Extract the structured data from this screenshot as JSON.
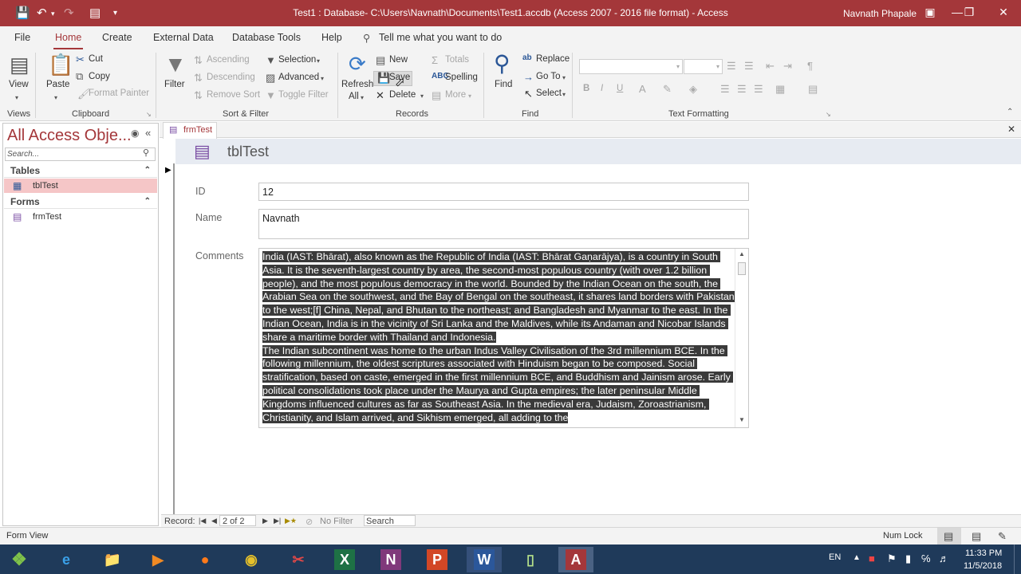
{
  "titlebar": {
    "title": "Test1 : Database- C:\\Users\\Navnath\\Documents\\Test1.accdb (Access 2007 - 2016 file format)  -  Access",
    "user": "Navnath Phapale"
  },
  "menu": {
    "items": [
      "File",
      "Home",
      "Create",
      "External Data",
      "Database Tools",
      "Help"
    ],
    "active": "Home",
    "tell_me": "Tell me what you want to do"
  },
  "ribbon": {
    "views": {
      "view": "View",
      "group": "Views"
    },
    "clipboard": {
      "paste": "Paste",
      "cut": "Cut",
      "copy": "Copy",
      "format_painter": "Format Painter",
      "group": "Clipboard"
    },
    "sort_filter": {
      "filter": "Filter",
      "ascending": "Ascending",
      "descending": "Descending",
      "remove_sort": "Remove Sort",
      "selection": "Selection",
      "advanced": "Advanced",
      "toggle_filter": "Toggle Filter",
      "group": "Sort & Filter"
    },
    "records": {
      "refresh": "Refresh",
      "refresh_all": "All",
      "new": "New",
      "save": "Save",
      "delete": "Delete",
      "totals": "Totals",
      "spelling": "Spelling",
      "more": "More",
      "group": "Records"
    },
    "find": {
      "find": "Find",
      "replace": "Replace",
      "goto": "Go To",
      "select": "Select",
      "group": "Find"
    },
    "text_formatting": {
      "bold": "B",
      "italic": "I",
      "underline": "U",
      "font_color": "A",
      "group": "Text Formatting"
    }
  },
  "nav": {
    "title": "All Access Obje...",
    "search_placeholder": "Search...",
    "groups": [
      {
        "label": "Tables",
        "items": [
          "tblTest"
        ]
      },
      {
        "label": "Forms",
        "items": [
          "frmTest"
        ]
      }
    ]
  },
  "doc": {
    "tab": "frmTest",
    "form_title": "tblTest"
  },
  "form": {
    "id_label": "ID",
    "id_value": "12",
    "name_label": "Name",
    "name_value": "Navnath",
    "comments_label": "Comments",
    "comments_value": "India (IAST: Bhārat), also known as the Republic of India (IAST: Bhārat Gaṇarājya), is a country in South Asia. It is the seventh-largest country by area, the second-most populous country (with over 1.2 billion people), and the most populous democracy in the world. Bounded by the Indian Ocean on the south, the Arabian Sea on the southwest, and the Bay of Bengal on the southeast, it shares land borders with Pakistan to the west;[f] China, Nepal, and Bhutan to the northeast; and Bangladesh and Myanmar to the east. In the Indian Ocean, India is in the vicinity of Sri Lanka and the Maldives, while its Andaman and Nicobar Islands share a maritime border with Thailand and Indonesia.\nThe Indian subcontinent was home to the urban Indus Valley Civilisation of the 3rd millennium BCE. In the following millennium, the oldest scriptures associated with Hinduism began to be composed. Social stratification, based on caste, emerged in the first millennium BCE, and Buddhism and Jainism arose. Early political consolidations took place under the Maurya and Gupta empires; the later peninsular Middle Kingdoms influenced cultures as far as Southeast Asia. In the medieval era, Judaism, Zoroastrianism, Christianity, and Islam arrived, and Sikhism emerged, all adding to the"
  },
  "recnav": {
    "record_label": "Record:",
    "position": "2 of 2",
    "filter": "No Filter",
    "search": "Search"
  },
  "status": {
    "left": "Form View",
    "num_lock": "Num Lock"
  },
  "taskbar": {
    "lang": "EN",
    "time": "11:33 PM",
    "date": "11/5/2018"
  },
  "colors": {
    "accent": "#a4373a",
    "selection": "#f5c6c7",
    "form_header": "#e7ebf2"
  }
}
